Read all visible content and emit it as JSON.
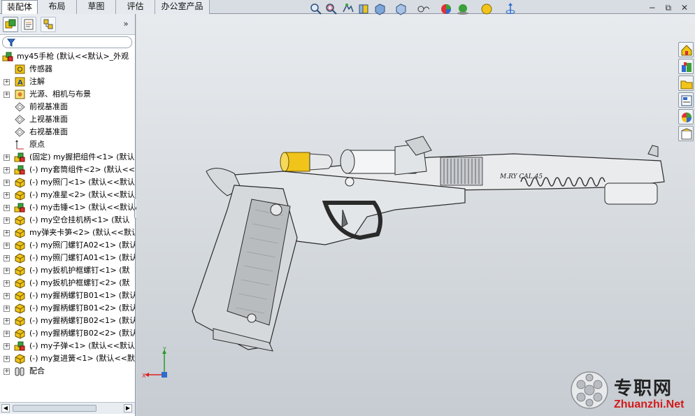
{
  "tabs": [
    {
      "label": "装配体",
      "active": true
    },
    {
      "label": "布局",
      "active": false
    },
    {
      "label": "草图",
      "active": false
    },
    {
      "label": "评估",
      "active": false
    },
    {
      "label": "办公室产品",
      "active": false
    }
  ],
  "panel": {
    "tools": [
      "feature-manager-icon",
      "property-manager-icon",
      "configuration-manager-icon"
    ],
    "collapse_label": "»"
  },
  "tree": {
    "root": "my45手枪  (默认<<默认>_外观",
    "items": [
      {
        "label": "传感器",
        "icon": "sensor-icon",
        "expand": ""
      },
      {
        "label": "注解",
        "icon": "annotation-icon",
        "expand": "+"
      },
      {
        "label": "光源、相机与布景",
        "icon": "lights-icon",
        "expand": "+"
      },
      {
        "label": "前视基准面",
        "icon": "plane-icon",
        "expand": ""
      },
      {
        "label": "上视基准面",
        "icon": "plane-icon",
        "expand": ""
      },
      {
        "label": "右视基准面",
        "icon": "plane-icon",
        "expand": ""
      },
      {
        "label": "原点",
        "icon": "origin-icon",
        "expand": ""
      },
      {
        "label": "(固定) my握把组件<1> (默认",
        "icon": "subassembly-icon",
        "expand": "+"
      },
      {
        "label": "(-) my套筒组件<2> (默认<<",
        "icon": "subassembly-icon",
        "expand": "+"
      },
      {
        "label": "(-) my照门<1> (默认<<默认",
        "icon": "part-icon",
        "expand": "+"
      },
      {
        "label": "(-) my准星<2> (默认<<默认",
        "icon": "part-icon",
        "expand": "+"
      },
      {
        "label": "(-) my击锤<1> (默认<<默认",
        "icon": "subassembly-icon",
        "expand": "+"
      },
      {
        "label": "(-) my空仓挂机柄<1> (默认",
        "icon": "part-icon",
        "expand": "+"
      },
      {
        "label": "my弹夹卡笋<2> (默认<<默认",
        "icon": "part-icon",
        "expand": "+"
      },
      {
        "label": "(-) my照门螺钉A02<1> (默认",
        "icon": "part-icon",
        "expand": "+"
      },
      {
        "label": "(-) my照门螺钉A01<1> (默认",
        "icon": "part-icon",
        "expand": "+"
      },
      {
        "label": "(-) my扳机护框螺钉<1> (默",
        "icon": "part-icon",
        "expand": "+"
      },
      {
        "label": "(-) my扳机护框螺钉<2> (默",
        "icon": "part-icon",
        "expand": "+"
      },
      {
        "label": "(-) my握柄螺钉B01<1> (默认",
        "icon": "part-icon",
        "expand": "+"
      },
      {
        "label": "(-) my握柄螺钉B01<2> (默认",
        "icon": "part-icon",
        "expand": "+"
      },
      {
        "label": "(-) my握柄螺钉B02<1> (默认",
        "icon": "part-icon",
        "expand": "+"
      },
      {
        "label": "(-) my握柄螺钉B02<2> (默认",
        "icon": "part-icon",
        "expand": "+"
      },
      {
        "label": "(-) my子弹<1> (默认<<默认",
        "icon": "subassembly-icon",
        "expand": "+"
      },
      {
        "label": "(-) my复进簧<1> (默认<<默",
        "icon": "part-icon",
        "expand": "+"
      },
      {
        "label": "配合",
        "icon": "mates-icon",
        "expand": "+"
      }
    ]
  },
  "view_toolbar": [
    "zoom-to-fit-icon",
    "zoom-to-area-icon",
    "previous-view-icon",
    "section-view-icon",
    "view-orientation-icon",
    "display-style-icon",
    "hide-show-items-icon",
    "edit-appearance-icon",
    "apply-scene-icon",
    "view-settings-icon",
    "rotate-icon"
  ],
  "window_controls": [
    "−",
    "⧉",
    "✕"
  ],
  "task_pane": [
    "home-icon",
    "design-library-icon",
    "file-explorer-icon",
    "view-palette-icon",
    "appearances-icon",
    "custom-properties-icon"
  ],
  "model": {
    "slide_engraving": "M.RY  CAL.45"
  },
  "triad": {
    "x": "X",
    "y": "Y"
  },
  "watermark": {
    "cn": "专职网",
    "en": "Zhuanzhi.Net"
  },
  "colors": {
    "part_yellow": "#f0c419",
    "viewport_top": "#e8ebee",
    "viewport_bottom": "#c6ccd2",
    "watermark_red": "#d21a1a"
  }
}
